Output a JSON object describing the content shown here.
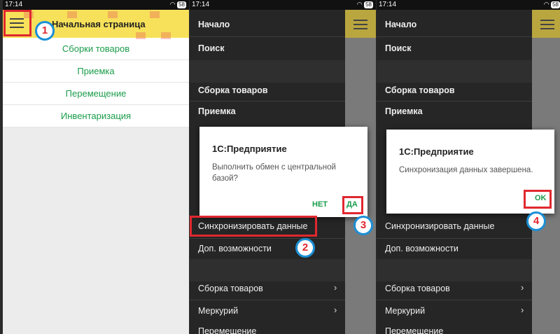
{
  "status_time": "17:14",
  "status_battery": "58",
  "screen1": {
    "title": "Начальная страница",
    "items": [
      "Сборки товаров",
      "Приемка",
      "Перемещение",
      "Инвентаризация"
    ]
  },
  "menu": {
    "nachalo": "Начало",
    "poisk": "Поиск",
    "sborka": "Сборка товаров",
    "priemka": "Приемка",
    "sync": "Синхронизировать данные",
    "dop": "Доп. возможности",
    "sborka2": "Сборка товаров",
    "merkuriy": "Меркурий",
    "peremeshchenie": "Перемещение"
  },
  "dialog1": {
    "title": "1С:Предприятие",
    "text1": "Выполнить обмен с центральной",
    "text2": "базой?",
    "no": "НЕТ",
    "yes": "ДА"
  },
  "dialog2": {
    "title": "1С:Предприятие",
    "text": "Синхронизация данных завершена.",
    "ok": "OK"
  },
  "badges": [
    "1",
    "2",
    "3",
    "4"
  ],
  "colors": {
    "accent_green": "#1a9c4a",
    "appbar_yellow": "#f7e15a",
    "highlight_red": "#e0282f",
    "badge_blue": "#1b8fd6"
  }
}
